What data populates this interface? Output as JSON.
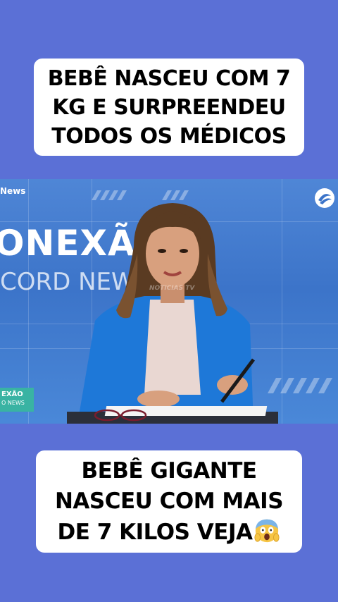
{
  "captions": {
    "top": "BEBÊ NASCEU COM 7 KG E SURPREENDEU TODOS OS MÉDICOS",
    "bottom": "BEBÊ GIGANTE NASCEU COM MAIS DE 7 KILOS VEJA"
  },
  "video": {
    "brand_topleft": "News",
    "background_title": "ONEXÃ",
    "background_subtitle": "CORD NEW",
    "watermark": "NOTICIAS TV",
    "lower_badge_line1": "EXÃO",
    "lower_badge_line2": "O NEWS",
    "logo_icon": "channel-logo-icon"
  },
  "colors": {
    "background": "#5b70d6",
    "caption_bg": "#ffffff",
    "jacket": "#1e78d8",
    "badge": "#39b3a3"
  }
}
